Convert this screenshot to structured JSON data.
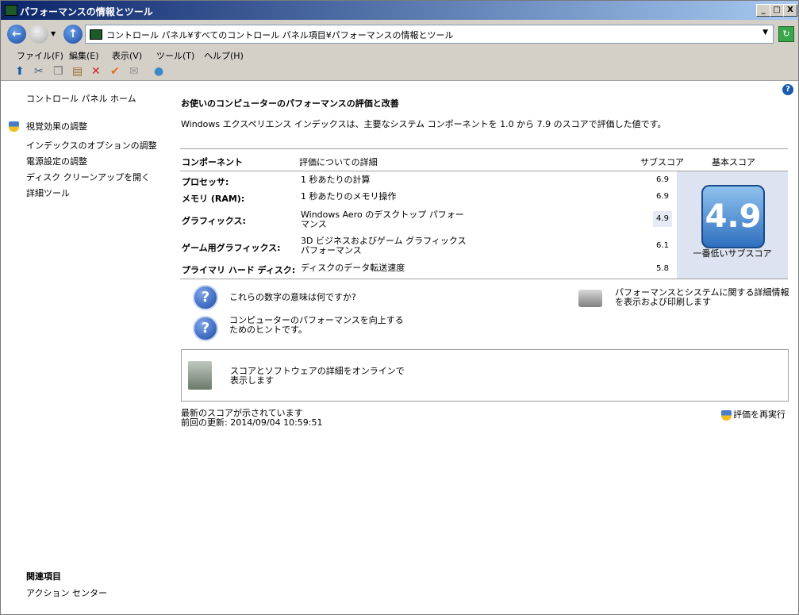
{
  "window": {
    "title": "パフォーマンスの情報とツール",
    "btn_min": "_",
    "btn_max": "□",
    "btn_close": "X"
  },
  "address": {
    "path": "コントロール パネル¥すべてのコントロール パネル項目¥パフォーマンスの情報とツール"
  },
  "menu": [
    "ファイル(F)",
    "編集(E)",
    "表示(V)",
    "ツール(T)",
    "ヘルプ(H)"
  ],
  "toolbar_icons": [
    "up-icon",
    "cut-icon",
    "copy-icon",
    "paste-icon",
    "delete-icon",
    "check-icon",
    "mail-icon",
    "globe-icon"
  ],
  "sidebar": {
    "home": "コントロール パネル ホーム",
    "items": [
      "視覚効果の調整",
      "インデックスのオプションの調整",
      "電源設定の調整",
      "ディスク クリーンアップを開く",
      "詳細ツール"
    ],
    "related_title": "関連項目",
    "related_items": [
      "アクション センター"
    ]
  },
  "main": {
    "title": "お使いのコンピューターのパフォーマンスの評価と改善",
    "description": "Windows エクスペリエンス インデックスは、主要なシステム コンポーネントを 1.0 から 7.9 のスコアで評価した値です。"
  },
  "score_table": {
    "headers": {
      "component": "コンポーネント",
      "details": "評価についての詳細",
      "subscore": "サブスコア",
      "basescore": "基本スコア"
    },
    "rows": [
      {
        "component": "プロセッサ:",
        "details": "1 秒あたりの計算",
        "subscore": "6.9"
      },
      {
        "component": "メモリ (RAM):",
        "details": "1 秒あたりのメモリ操作",
        "subscore": "6.9"
      },
      {
        "component": "グラフィックス:",
        "details": "Windows Aero のデスクトップ パフォーマンス",
        "subscore": "4.9"
      },
      {
        "component": "ゲーム用グラフィックス:",
        "details": "3D ビジネスおよびゲーム グラフィックス パフォーマンス",
        "subscore": "6.1"
      },
      {
        "component": "プライマリ ハード ディスク:",
        "details": "ディスクのデータ転送速度",
        "subscore": "5.8"
      }
    ],
    "base_score": "4.9",
    "base_label": "一番低いサブスコア"
  },
  "links": {
    "meaning": "これらの数字の意味は何ですか?",
    "improve": "コンピューターのパフォーマンスを向上するためのヒントです。",
    "print": "パフォーマンスとシステムに関する詳細情報を表示および印刷します",
    "online": "スコアとソフトウェアの詳細をオンラインで表示します"
  },
  "footer": {
    "status": "最新のスコアが示されています",
    "updated": "前回の更新: 2014/09/04 10:59:51",
    "rerun": "評価を再実行"
  }
}
